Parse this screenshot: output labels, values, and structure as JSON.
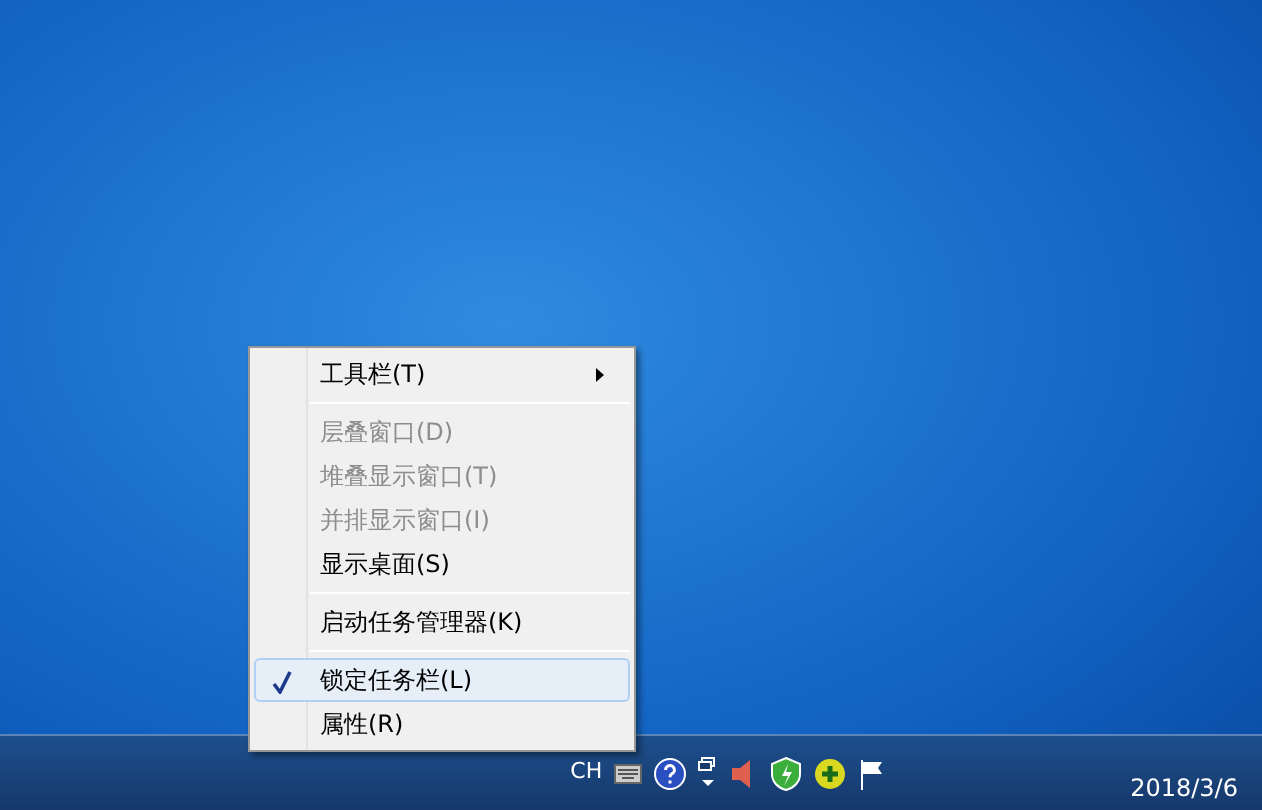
{
  "context_menu": {
    "items": [
      {
        "kind": "item",
        "label": "工具栏(T)",
        "submenu": true,
        "disabled": false,
        "checked": false,
        "selected": false
      },
      {
        "kind": "separator"
      },
      {
        "kind": "item",
        "label": "层叠窗口(D)",
        "submenu": false,
        "disabled": true,
        "checked": false,
        "selected": false
      },
      {
        "kind": "item",
        "label": "堆叠显示窗口(T)",
        "submenu": false,
        "disabled": true,
        "checked": false,
        "selected": false
      },
      {
        "kind": "item",
        "label": "并排显示窗口(I)",
        "submenu": false,
        "disabled": true,
        "checked": false,
        "selected": false
      },
      {
        "kind": "item",
        "label": "显示桌面(S)",
        "submenu": false,
        "disabled": false,
        "checked": false,
        "selected": false
      },
      {
        "kind": "separator"
      },
      {
        "kind": "item",
        "label": "启动任务管理器(K)",
        "submenu": false,
        "disabled": false,
        "checked": false,
        "selected": false
      },
      {
        "kind": "separator"
      },
      {
        "kind": "item",
        "label": "锁定任务栏(L)",
        "submenu": false,
        "disabled": false,
        "checked": true,
        "selected": true
      },
      {
        "kind": "item",
        "label": "属性(R)",
        "submenu": false,
        "disabled": false,
        "checked": false,
        "selected": false
      }
    ]
  },
  "taskbar": {
    "language": "CH",
    "date": "2018/3/6"
  }
}
